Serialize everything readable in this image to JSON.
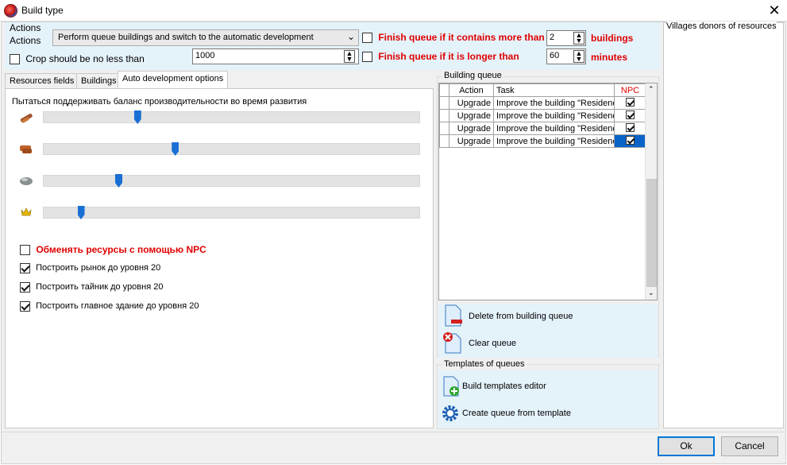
{
  "window": {
    "title": "Build type",
    "close_glyph": "✕"
  },
  "actions": {
    "label1": "Actions",
    "label2": "Actions",
    "combo_value": "Perform queue buildings and switch to the automatic development",
    "crop_label": "Crop should be no less than",
    "crop_value": "1000",
    "finish_count_label": "Finish queue if it contains more than",
    "finish_count_value": "2",
    "finish_count_unit": "buildings",
    "finish_time_label": "Finish queue if it is longer than",
    "finish_time_value": "60",
    "finish_time_unit": "minutes"
  },
  "tabs": [
    "Resources fields",
    "Buildings",
    "Auto development options"
  ],
  "auto_dev": {
    "balance_label": "Пытаться поддерживать баланс производительности во время развития",
    "sliders": [
      {
        "resource": "wood-icon",
        "level": 0.25
      },
      {
        "resource": "clay-icon",
        "level": 0.35
      },
      {
        "resource": "iron-icon",
        "level": 0.2
      },
      {
        "resource": "crop-icon",
        "level": 0.1
      }
    ],
    "npc_label": "Обменять ресурсы с помощью NPC",
    "market_label": "Построить рынок до уровня 20",
    "cache_label": "Построить тайник до уровня 20",
    "main_label": "Построить главное здание до уровня 20"
  },
  "building_queue": {
    "title": "Building queue",
    "columns": [
      "Action",
      "Task",
      "NPC"
    ],
    "rows": [
      {
        "action": "Upgrade",
        "task": "Improve the building \"Residence\""
      },
      {
        "action": "Upgrade",
        "task": "Improve the building \"Residence\""
      },
      {
        "action": "Upgrade",
        "task": "Improve the building \"Residence\""
      },
      {
        "action": "Upgrade",
        "task": "Improve the building \"Residence\""
      }
    ],
    "delete_label": "Delete from building queue",
    "clear_label": "Clear queue"
  },
  "templates": {
    "title": "Templates of queues",
    "editor_label": "Build templates editor",
    "create_label": "Create queue from template"
  },
  "donors": {
    "title": "Villages donors of resources"
  },
  "footer": {
    "ok_label": "Ok",
    "cancel_label": "Cancel"
  },
  "colors": {
    "accent": "#0078d7",
    "warning_red": "#e00000",
    "toolbar_bg": "#e4f2fa",
    "slider_thumb": "#1a6fd4"
  }
}
